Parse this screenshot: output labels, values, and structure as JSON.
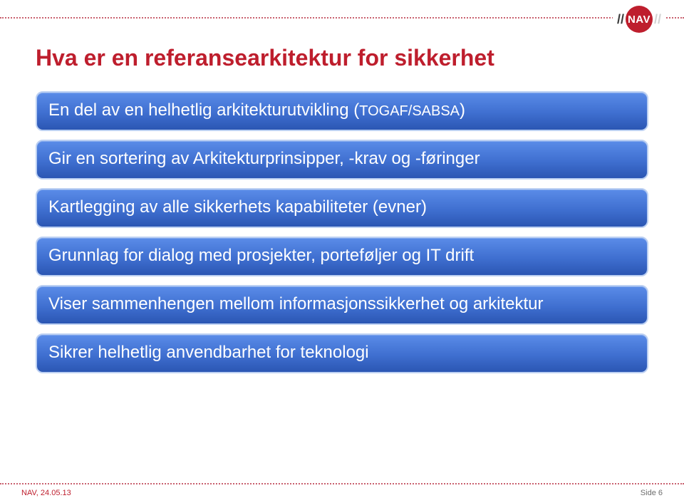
{
  "brand": {
    "name": "NAV",
    "slash": "//",
    "color": "#be1e2d"
  },
  "title": "Hva er en referansearkitektur for sikkerhet",
  "bullets": [
    {
      "text_a": "En del av en helhetlig arkitekturutvikling (",
      "paren": "TOGAF/SABSA",
      "text_b": ")"
    },
    {
      "text_a": "Gir en sortering av Arkitekturprinsipper, -krav og -føringer",
      "paren": "",
      "text_b": ""
    },
    {
      "text_a": "Kartlegging av alle sikkerhets kapabiliteter (evner)",
      "paren": "",
      "text_b": ""
    },
    {
      "text_a": "Grunnlag for dialog med prosjekter, porteføljer og IT drift",
      "paren": "",
      "text_b": ""
    },
    {
      "text_a": "Viser sammenhengen mellom informasjonssikkerhet og arkitektur",
      "paren": "",
      "text_b": ""
    },
    {
      "text_a": "Sikrer helhetlig anvendbarhet for teknologi",
      "paren": "",
      "text_b": ""
    }
  ],
  "footer": {
    "left_prefix": "NAV,",
    "date": "24.05.13",
    "right": "Side 6"
  }
}
